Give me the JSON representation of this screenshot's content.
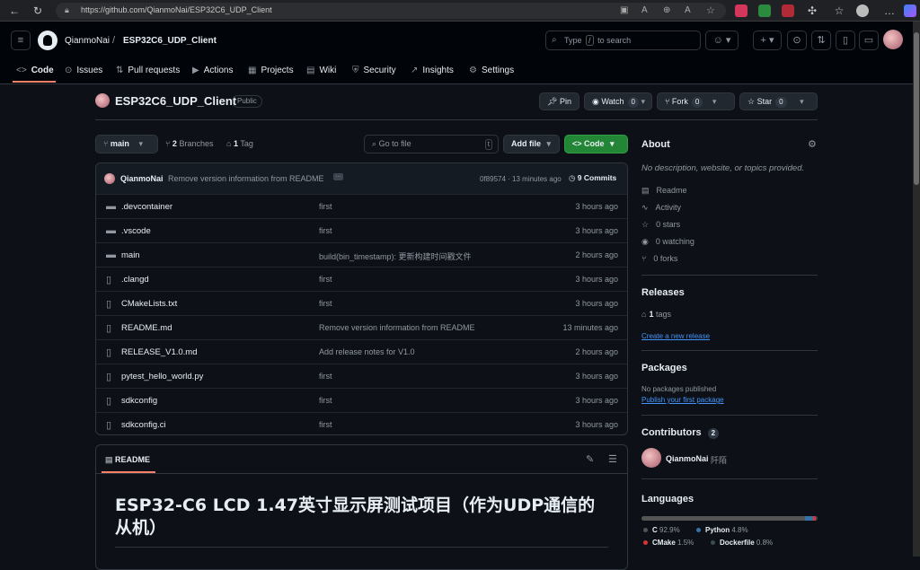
{
  "browser": {
    "url": "https://github.com/QianmoNai/ESP32C6_UDP_Client"
  },
  "header": {
    "owner": "QianmoNai",
    "slash": "/",
    "repo": "ESP32C6_UDP_Client",
    "search_placeholder_a": "Type",
    "search_key": "/",
    "search_placeholder_b": "to search",
    "plus": "+"
  },
  "tabs": [
    {
      "label": "Code",
      "icon": "<>"
    },
    {
      "label": "Issues",
      "icon": "⊙"
    },
    {
      "label": "Pull requests",
      "icon": "⇅"
    },
    {
      "label": "Actions",
      "icon": "▶"
    },
    {
      "label": "Projects",
      "icon": "▦"
    },
    {
      "label": "Wiki",
      "icon": "▤"
    },
    {
      "label": "Security",
      "icon": "⛨"
    },
    {
      "label": "Insights",
      "icon": "↗"
    },
    {
      "label": "Settings",
      "icon": "⚙"
    }
  ],
  "repo": {
    "name": "ESP32C6_UDP_Client",
    "visibility": "Public",
    "pin": "Pin",
    "watch": "Watch",
    "watch_count": "0",
    "fork": "Fork",
    "fork_count": "0",
    "star": "Star",
    "star_count": "0"
  },
  "toolbar": {
    "branch": "main",
    "branches": "2",
    "branches_label": "Branches",
    "tags": "1",
    "tags_label": "Tag",
    "goto": "Go to file",
    "goto_key": "t",
    "add_file": "Add file",
    "code": "Code"
  },
  "commit": {
    "author": "QianmoNai",
    "message": "Remove version information from README",
    "hash": "0f89574 · 13 minutes ago",
    "commits": "9 Commits"
  },
  "files": [
    {
      "name": ".devcontainer",
      "type": "dir",
      "msg": "first",
      "time": "3 hours ago"
    },
    {
      "name": ".vscode",
      "type": "dir",
      "msg": "first",
      "time": "3 hours ago"
    },
    {
      "name": "main",
      "type": "dir",
      "msg": "build(bin_timestamp): 更新构建时间戳文件",
      "time": "2 hours ago"
    },
    {
      "name": ".clangd",
      "type": "file",
      "msg": "first",
      "time": "3 hours ago"
    },
    {
      "name": "CMakeLists.txt",
      "type": "file",
      "msg": "first",
      "time": "3 hours ago"
    },
    {
      "name": "README.md",
      "type": "file",
      "msg": "Remove version information from README",
      "time": "13 minutes ago"
    },
    {
      "name": "RELEASE_V1.0.md",
      "type": "file",
      "msg": "Add release notes for V1.0",
      "time": "2 hours ago"
    },
    {
      "name": "pytest_hello_world.py",
      "type": "file",
      "msg": "first",
      "time": "3 hours ago"
    },
    {
      "name": "sdkconfig",
      "type": "file",
      "msg": "first",
      "time": "3 hours ago"
    },
    {
      "name": "sdkconfig.ci",
      "type": "file",
      "msg": "first",
      "time": "3 hours ago"
    }
  ],
  "readme": {
    "tab": "README",
    "title_line1": "ESP32-C6 LCD 1.47英寸显示屏测试项目（作为UDP通信的",
    "title_line2": "从机）"
  },
  "about": {
    "heading": "About",
    "desc": "No description, website, or topics provided.",
    "readme": "Readme",
    "activity": "Activity",
    "stars": "0 stars",
    "watching": "0 watching",
    "forks": "0 forks"
  },
  "releases": {
    "heading": "Releases",
    "tags_count": "1",
    "tags_label": "tags",
    "create": "Create a new release"
  },
  "packages": {
    "heading": "Packages",
    "none": "No packages published",
    "publish": "Publish your first package"
  },
  "contributors": {
    "heading": "Contributors",
    "count": "2",
    "name": "QianmoNai",
    "alias": "阡陌"
  },
  "languages": {
    "heading": "Languages",
    "items": [
      {
        "name": "C",
        "pct": "92.9%",
        "value": 92.9,
        "color": "#555555"
      },
      {
        "name": "Python",
        "pct": "4.8%",
        "value": 4.8,
        "color": "#3572A5"
      },
      {
        "name": "CMake",
        "pct": "1.5%",
        "value": 1.5,
        "color": "#DA3434"
      },
      {
        "name": "Dockerfile",
        "pct": "0.8%",
        "value": 0.8,
        "color": "#384d54"
      }
    ]
  }
}
